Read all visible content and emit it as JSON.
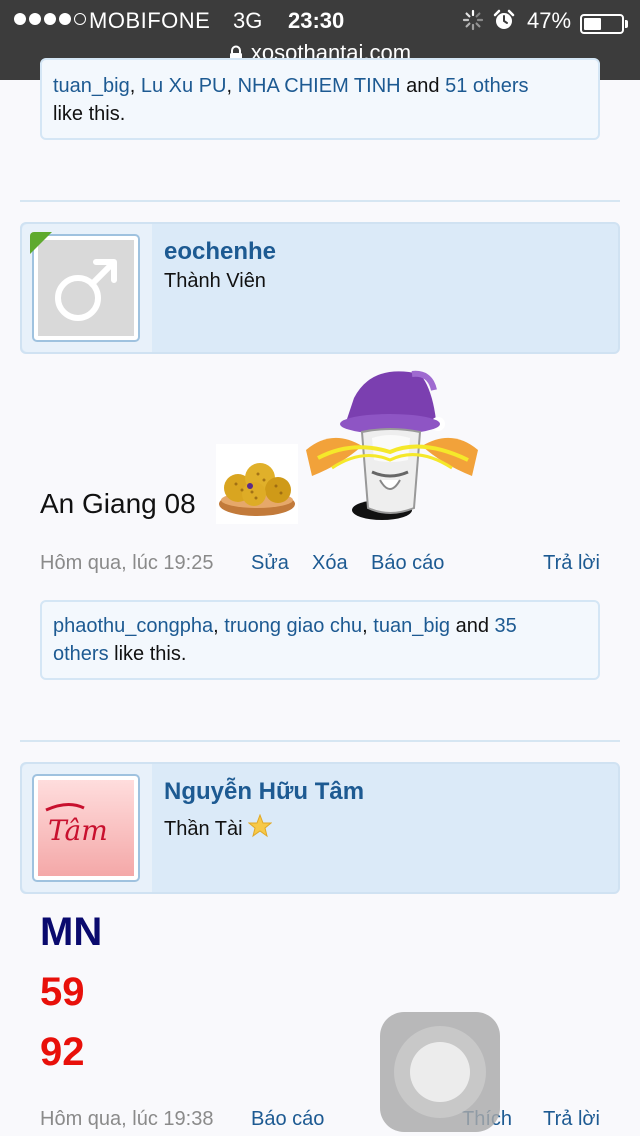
{
  "status_bar": {
    "carrier": "MOBIFONE",
    "network": "3G",
    "time": "23:30",
    "battery": "47%",
    "battery_level": 0.47,
    "signal_bars_filled": 4,
    "signal_bars_total": 5
  },
  "browser": {
    "url": "xosothantai.com"
  },
  "post_top": {
    "likes": {
      "users": [
        "tuan_big",
        "Lu Xu PU",
        "NHA CHIEM TINH"
      ],
      "and_text": "and",
      "others": "51 others",
      "suffix": "like this."
    }
  },
  "post_1": {
    "username": "eochenhe",
    "user_title": "Thành Viên",
    "avatar_icon": "male-symbol-icon",
    "message": "An Giang 08",
    "smiley_1": "fruit-basket-emoticon",
    "smiley_2": "wizard-emoticon",
    "timestamp": "Hôm qua, lúc 19:25",
    "edit_label": "Sửa",
    "delete_label": "Xóa",
    "report_label": "Báo cáo",
    "reply_label": "Trả lời",
    "likes": {
      "users": [
        "phaothu_congpha",
        "truong giao chu",
        "tuan_big"
      ],
      "and_text": "and",
      "others_1": "35",
      "others_2": "others",
      "suffix": "like this."
    }
  },
  "post_2": {
    "username": "Nguyễn Hữu Tâm",
    "user_title": "Thần Tài",
    "avatar_text": "Tâm",
    "line_1": "MN",
    "line_2": "59",
    "line_3": "92",
    "timestamp": "Hôm qua, lúc 19:38",
    "report_label": "Báo cáo",
    "like_label": "Thích",
    "reply_label": "Trả lời"
  },
  "colors": {
    "link": "#1d5a92",
    "mn": "#0a0a6e",
    "number": "#e8100a"
  }
}
